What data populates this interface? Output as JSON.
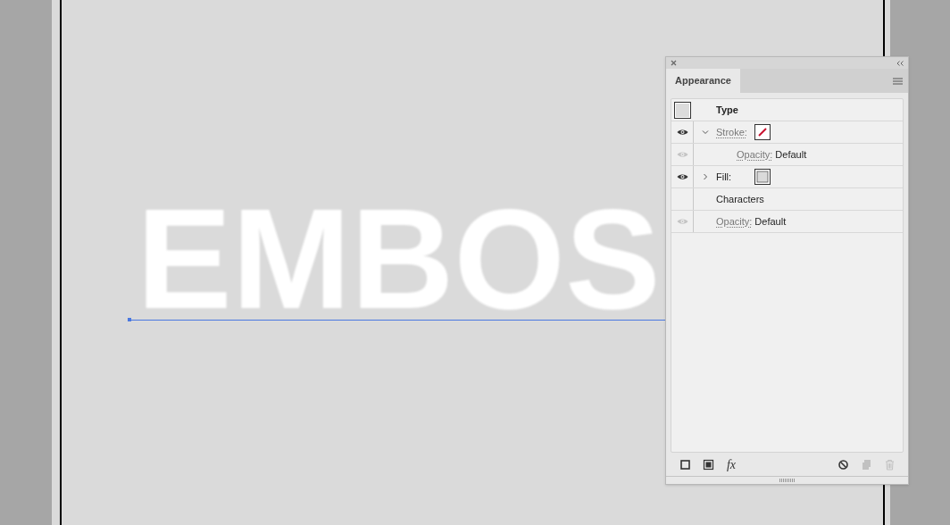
{
  "canvas": {
    "artwork_text": "EMBOS"
  },
  "panel": {
    "tab": {
      "label": "Appearance",
      "selected": true
    },
    "rows": [
      {
        "kind": "header",
        "label": "Type"
      },
      {
        "kind": "attribute",
        "label": "Stroke:",
        "visible": true,
        "expanded": true,
        "swatch_empty": true,
        "children": [
          {
            "kind": "property",
            "label": "Opacity:",
            "value": "Default",
            "visible": false
          }
        ]
      },
      {
        "kind": "attribute",
        "label": "Fill:",
        "visible": true,
        "expanded": false,
        "swatch_empty": false
      },
      {
        "kind": "group",
        "label": "Characters"
      },
      {
        "kind": "property",
        "label": "Opacity:",
        "value": "Default",
        "visible": false
      }
    ],
    "toolbar": [
      {
        "kind": "stroke",
        "disabled": false
      },
      {
        "kind": "fill",
        "disabled": false
      },
      {
        "kind": "fx",
        "label": "fx",
        "disabled": false
      },
      {
        "kind": "clear",
        "disabled": false
      },
      {
        "kind": "duplicate",
        "disabled": true
      },
      {
        "kind": "delete",
        "disabled": true
      }
    ]
  }
}
